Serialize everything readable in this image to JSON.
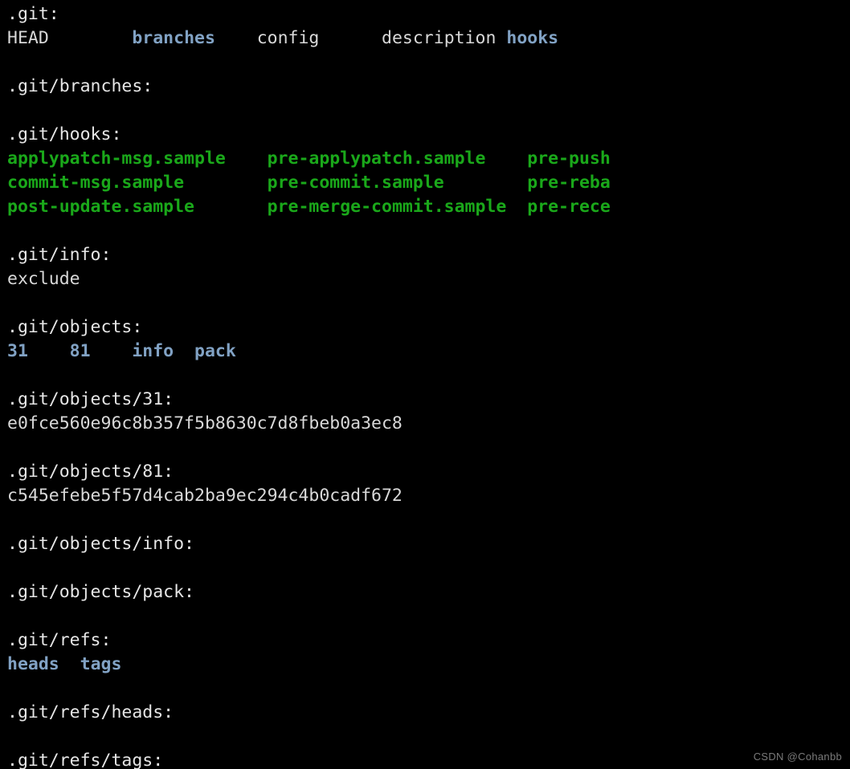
{
  "terminal": {
    "background_color": "#000000",
    "default_text_color": "#d8d8d8",
    "directory_color": "#81a2c4",
    "executable_color": "#1aa81a",
    "command_output_kind": "ls -R .git"
  },
  "watermark": {
    "text": "CSDN @Cohanbb",
    "color": "#7a7a7a"
  },
  "sections": [
    {
      "header": ".git:",
      "entries": [
        {
          "name": "HEAD",
          "type": "file"
        },
        {
          "name": "branches",
          "type": "dir"
        },
        {
          "name": "config",
          "type": "file"
        },
        {
          "name": "description",
          "type": "file"
        },
        {
          "name": "hooks",
          "type": "dir"
        }
      ]
    },
    {
      "header": ".git/branches:",
      "entries": []
    },
    {
      "header": ".git/hooks:",
      "entries": [
        {
          "name": "applypatch-msg.sample",
          "type": "exec"
        },
        {
          "name": "pre-applypatch.sample",
          "type": "exec"
        },
        {
          "name": "pre-push",
          "type": "exec"
        },
        {
          "name": "commit-msg.sample",
          "type": "exec"
        },
        {
          "name": "pre-commit.sample",
          "type": "exec"
        },
        {
          "name": "pre-reba",
          "type": "exec"
        },
        {
          "name": "post-update.sample",
          "type": "exec"
        },
        {
          "name": "pre-merge-commit.sample",
          "type": "exec"
        },
        {
          "name": "pre-rece",
          "type": "exec"
        }
      ]
    },
    {
      "header": ".git/info:",
      "entries": [
        {
          "name": "exclude",
          "type": "file"
        }
      ]
    },
    {
      "header": ".git/objects:",
      "entries": [
        {
          "name": "31",
          "type": "dir"
        },
        {
          "name": "81",
          "type": "dir"
        },
        {
          "name": "info",
          "type": "dir"
        },
        {
          "name": "pack",
          "type": "dir"
        }
      ]
    },
    {
      "header": ".git/objects/31:",
      "entries": [
        {
          "name": "e0fce560e96c8b357f5b8630c7d8fbeb0a3ec8",
          "type": "file"
        }
      ]
    },
    {
      "header": ".git/objects/81:",
      "entries": [
        {
          "name": "c545efebe5f57d4cab2ba9ec294c4b0cadf672",
          "type": "file"
        }
      ]
    },
    {
      "header": ".git/objects/info:",
      "entries": []
    },
    {
      "header": ".git/objects/pack:",
      "entries": []
    },
    {
      "header": ".git/refs:",
      "entries": [
        {
          "name": "heads",
          "type": "dir"
        },
        {
          "name": "tags",
          "type": "dir"
        }
      ]
    },
    {
      "header": ".git/refs/heads:",
      "entries": []
    },
    {
      "header": ".git/refs/tags:",
      "entries": []
    }
  ],
  "rendered_lines": [
    {
      "kind": "header",
      "text": ".git:"
    },
    {
      "kind": "entries",
      "cells": [
        {
          "text": "HEAD",
          "type": "file",
          "pad": 12
        },
        {
          "text": "branches",
          "type": "dir",
          "pad": 12
        },
        {
          "text": "config",
          "type": "file",
          "pad": 12
        },
        {
          "text": "description",
          "type": "file",
          "pad": 12
        },
        {
          "text": "hooks",
          "type": "dir",
          "pad": 0
        }
      ]
    },
    {
      "kind": "blank"
    },
    {
      "kind": "header",
      "text": ".git/branches:"
    },
    {
      "kind": "blank"
    },
    {
      "kind": "header",
      "text": ".git/hooks:"
    },
    {
      "kind": "entries",
      "cells": [
        {
          "text": "applypatch-msg.sample",
          "type": "exec",
          "pad": 25
        },
        {
          "text": "pre-applypatch.sample",
          "type": "exec",
          "pad": 25
        },
        {
          "text": "pre-push",
          "type": "exec",
          "pad": 0
        }
      ]
    },
    {
      "kind": "entries",
      "cells": [
        {
          "text": "commit-msg.sample",
          "type": "exec",
          "pad": 25
        },
        {
          "text": "pre-commit.sample",
          "type": "exec",
          "pad": 25
        },
        {
          "text": "pre-reba",
          "type": "exec",
          "pad": 0
        }
      ]
    },
    {
      "kind": "entries",
      "cells": [
        {
          "text": "post-update.sample",
          "type": "exec",
          "pad": 25
        },
        {
          "text": "pre-merge-commit.sample",
          "type": "exec",
          "pad": 25
        },
        {
          "text": "pre-rece",
          "type": "exec",
          "pad": 0
        }
      ]
    },
    {
      "kind": "blank"
    },
    {
      "kind": "header",
      "text": ".git/info:"
    },
    {
      "kind": "entries",
      "cells": [
        {
          "text": "exclude",
          "type": "file",
          "pad": 0
        }
      ]
    },
    {
      "kind": "blank"
    },
    {
      "kind": "header",
      "text": ".git/objects:"
    },
    {
      "kind": "entries",
      "cells": [
        {
          "text": "31",
          "type": "dir",
          "pad": 6
        },
        {
          "text": "81",
          "type": "dir",
          "pad": 6
        },
        {
          "text": "info",
          "type": "dir",
          "pad": 6
        },
        {
          "text": "pack",
          "type": "dir",
          "pad": 0
        }
      ]
    },
    {
      "kind": "blank"
    },
    {
      "kind": "header",
      "text": ".git/objects/31:"
    },
    {
      "kind": "entries",
      "cells": [
        {
          "text": "e0fce560e96c8b357f5b8630c7d8fbeb0a3ec8",
          "type": "file",
          "pad": 0
        }
      ]
    },
    {
      "kind": "blank"
    },
    {
      "kind": "header",
      "text": ".git/objects/81:"
    },
    {
      "kind": "entries",
      "cells": [
        {
          "text": "c545efebe5f57d4cab2ba9ec294c4b0cadf672",
          "type": "file",
          "pad": 0
        }
      ]
    },
    {
      "kind": "blank"
    },
    {
      "kind": "header",
      "text": ".git/objects/info:"
    },
    {
      "kind": "blank"
    },
    {
      "kind": "header",
      "text": ".git/objects/pack:"
    },
    {
      "kind": "blank"
    },
    {
      "kind": "header",
      "text": ".git/refs:"
    },
    {
      "kind": "entries",
      "cells": [
        {
          "text": "heads",
          "type": "dir",
          "pad": 7
        },
        {
          "text": "tags",
          "type": "dir",
          "pad": 0
        }
      ]
    },
    {
      "kind": "blank"
    },
    {
      "kind": "header",
      "text": ".git/refs/heads:"
    },
    {
      "kind": "blank"
    },
    {
      "kind": "header",
      "text": ".git/refs/tags:"
    }
  ]
}
